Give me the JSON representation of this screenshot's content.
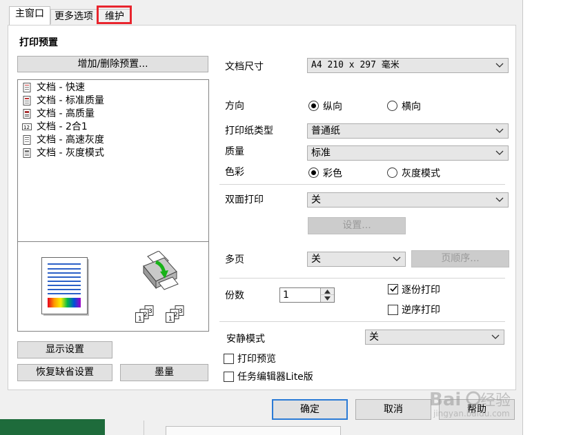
{
  "tabs": [
    {
      "label": "主窗口"
    },
    {
      "label": "更多选项"
    },
    {
      "label": "维护"
    }
  ],
  "left": {
    "section_title": "打印预置",
    "add_remove_button": "增加/删除预置...",
    "presets": [
      {
        "label": "文档 - 快速",
        "icon": "document-fast-icon"
      },
      {
        "label": "文档 - 标准质量",
        "icon": "document-standard-icon"
      },
      {
        "label": "文档 - 高质量",
        "icon": "document-high-quality-icon"
      },
      {
        "label": "文档 - 2合1",
        "icon": "two-in-one-icon"
      },
      {
        "label": "文档 - 高速灰度",
        "icon": "document-grayscale-fast-icon"
      },
      {
        "label": "文档 - 灰度模式",
        "icon": "document-grayscale-icon"
      }
    ],
    "show_settings_button": "显示设置",
    "restore_defaults_button": "恢复缺省设置",
    "ink_button": "墨量"
  },
  "right": {
    "paper_size": {
      "label": "文档尺寸",
      "value": "A4 210 x 297 毫米"
    },
    "orientation": {
      "label": "方向",
      "options": [
        "纵向",
        "横向"
      ],
      "selected": "纵向"
    },
    "paper_type": {
      "label": "打印纸类型",
      "value": "普通纸"
    },
    "quality": {
      "label": "质量",
      "value": "标准"
    },
    "color": {
      "label": "色彩",
      "options": [
        "彩色",
        "灰度模式"
      ],
      "selected": "彩色"
    },
    "duplex": {
      "label": "双面打印",
      "value": "关",
      "settings_button": "设置..."
    },
    "multipage": {
      "label": "多页",
      "value": "关",
      "page_order_button": "页顺序..."
    },
    "copies": {
      "label": "份数",
      "value": "1",
      "collate_label": "逐份打印",
      "collate_checked": true,
      "reverse_label": "逆序打印",
      "reverse_checked": false
    },
    "quiet_mode": {
      "label": "安静模式",
      "value": "关"
    },
    "print_preview": {
      "label": "打印预览",
      "checked": false
    },
    "job_arranger": {
      "label": "任务编辑器Lite版",
      "checked": false
    }
  },
  "footer": {
    "ok_button": "确定",
    "cancel_button": "取消",
    "help_button": "帮助"
  },
  "watermark": "Baidu经验 jingyan.baidu.com",
  "colors": {
    "tab_highlight": "#e8242d",
    "focus_blue": "#2a7ad5",
    "taskbar_green": "#1e6b3b"
  }
}
